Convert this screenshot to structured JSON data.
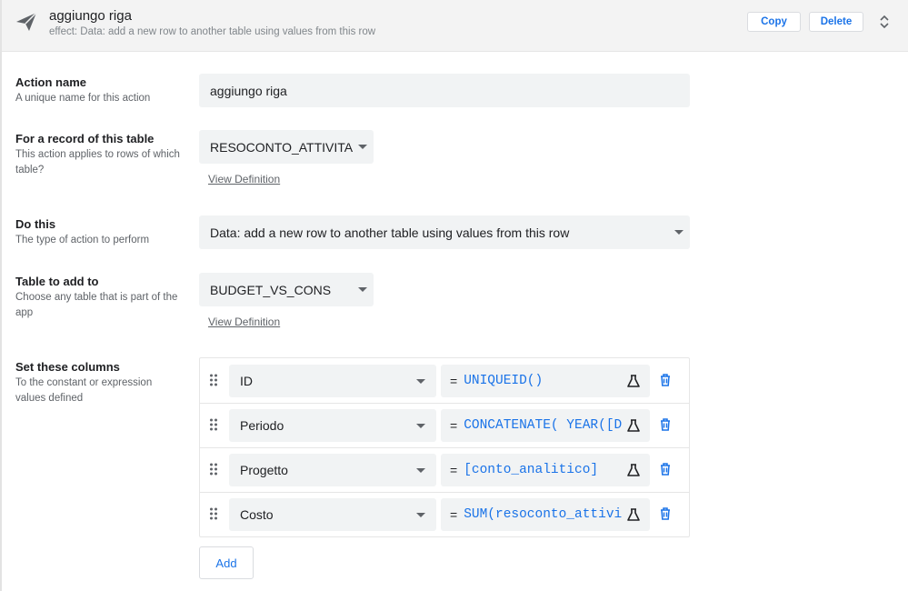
{
  "header": {
    "title": "aggiungo riga",
    "subtitle": "effect: Data: add a new row to another table using values from this row",
    "copy_label": "Copy",
    "delete_label": "Delete"
  },
  "action_name": {
    "label": "Action name",
    "description": "A unique name for this action",
    "value": "aggiungo riga"
  },
  "record_table": {
    "label": "For a record of this table",
    "description": "This action applies to rows of which table?",
    "value": "RESOCONTO_ATTIVITA",
    "link": "View Definition"
  },
  "do_this": {
    "label": "Do this",
    "description": "The type of action to perform",
    "value": "Data: add a new row to another table using values from this row"
  },
  "table_to_add": {
    "label": "Table to add to",
    "description": "Choose any table that is part of the app",
    "value": "BUDGET_VS_CONS",
    "link": "View Definition"
  },
  "set_columns": {
    "label": "Set these columns",
    "description": "To the constant or expression values defined",
    "rows": [
      {
        "column": "ID",
        "expression": "UNIQUEID()"
      },
      {
        "column": "Periodo",
        "expression": "CONCATENATE( YEAR([D"
      },
      {
        "column": "Progetto",
        "expression": "[conto_analitico]"
      },
      {
        "column": "Costo",
        "expression": "SUM(resoconto_attivi"
      }
    ],
    "equals": "=",
    "add_label": "Add"
  },
  "icons": [
    "send-icon",
    "expand-icon",
    "drag-handle-icon",
    "flask-icon",
    "trash-icon"
  ],
  "colors": {
    "accent": "#1a73e8",
    "field_bg": "#f1f3f4",
    "header_bg": "#f3f3f3"
  }
}
